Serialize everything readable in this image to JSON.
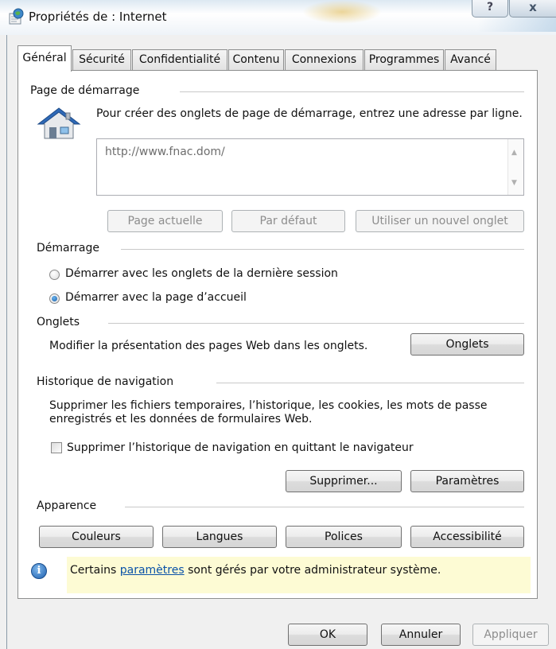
{
  "window": {
    "title": "Propriétés de : Internet",
    "help_label": "?",
    "close_label": "x"
  },
  "tabs": [
    {
      "label": "Général",
      "active": true
    },
    {
      "label": "Sécurité"
    },
    {
      "label": "Confidentialité"
    },
    {
      "label": "Contenu"
    },
    {
      "label": "Connexions"
    },
    {
      "label": "Programmes"
    },
    {
      "label": "Avancé"
    }
  ],
  "homepage": {
    "group_title": "Page de démarrage",
    "description": "Pour créer des onglets de page de démarrage, entrez une adresse par ligne.",
    "value": "http://www.fnac.dom/",
    "buttons": {
      "current": "Page actuelle",
      "default": "Par défaut",
      "new_tab": "Utiliser un nouvel onglet"
    }
  },
  "startup": {
    "group_title": "Démarrage",
    "options": [
      {
        "label": "Démarrer avec les onglets de la dernière session",
        "checked": false
      },
      {
        "label": "Démarrer avec la page d’accueil",
        "checked": true
      }
    ]
  },
  "tabs_group": {
    "group_title": "Onglets",
    "description": "Modifier la présentation des pages Web dans les onglets.",
    "button": "Onglets"
  },
  "history": {
    "group_title": "Historique de navigation",
    "description_line1": "Supprimer les fichiers temporaires, l’historique, les cookies, les mots de passe",
    "description_line2": "enregistrés et les données de formulaires Web.",
    "checkbox_label": "Supprimer l’historique de navigation en quittant le navigateur",
    "checkbox_checked": false,
    "delete_button": "Supprimer...",
    "settings_button": "Paramètres"
  },
  "appearance": {
    "group_title": "Apparence",
    "buttons": {
      "colors": "Couleurs",
      "languages": "Langues",
      "fonts": "Polices",
      "accessibility": "Accessibilité"
    }
  },
  "notice": {
    "prefix": "Certains ",
    "link": "paramètres",
    "suffix": " sont gérés par votre administrateur système."
  },
  "footer": {
    "ok": "OK",
    "cancel": "Annuler",
    "apply": "Appliquer"
  }
}
